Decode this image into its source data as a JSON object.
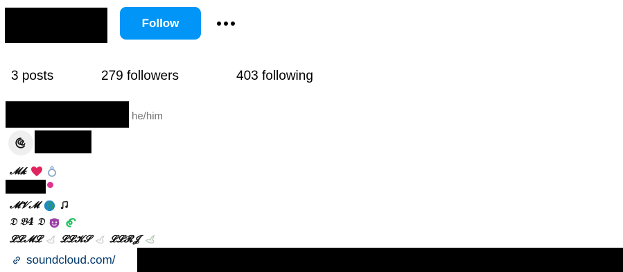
{
  "header": {
    "follow_label": "Follow",
    "more_icon": "more-options-icon"
  },
  "stats": {
    "posts": "3 posts",
    "followers": "279 followers",
    "following": "403 following"
  },
  "bio": {
    "pronouns": "he/him",
    "line1_text": "𝓜𝓴",
    "line3_text": "𝓜𝓥𝓜",
    "line4_text": "𝔇 𝔅4 𝔇",
    "line5_a": "𝓛𝓛𝓜𝓛",
    "line5_b": "𝓛𝓛𝓚𝓢",
    "line5_c": "𝓛𝓛𝓡𝓙"
  },
  "link": {
    "text": "soundcloud.com/"
  },
  "colors": {
    "accent": "#0095f6",
    "link": "#00376b",
    "muted": "#737373"
  }
}
